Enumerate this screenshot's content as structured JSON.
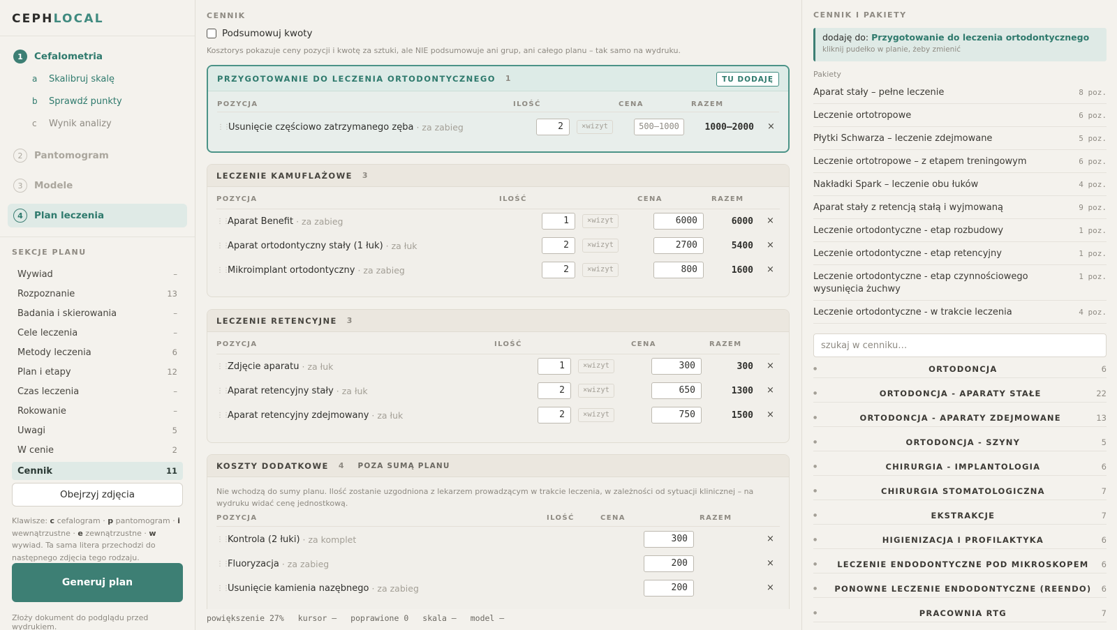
{
  "app": {
    "logo_a": "CEPH",
    "logo_b": "LOCAL"
  },
  "steps": [
    {
      "num": "1",
      "label": "Cefalometria"
    },
    {
      "num": "2",
      "label": "Pantomogram"
    },
    {
      "num": "3",
      "label": "Modele"
    },
    {
      "num": "4",
      "label": "Plan leczenia"
    }
  ],
  "substeps": [
    {
      "letter": "a",
      "label": "Skalibruj skalę"
    },
    {
      "letter": "b",
      "label": "Sprawdź punkty"
    },
    {
      "letter": "c",
      "label": "Wynik analizy"
    }
  ],
  "plan_sections": {
    "title": "SEKCJE PLANU",
    "items": [
      {
        "label": "Wywiad",
        "count": "–"
      },
      {
        "label": "Rozpoznanie",
        "count": "13"
      },
      {
        "label": "Badania i skierowania",
        "count": "–"
      },
      {
        "label": "Cele leczenia",
        "count": "–"
      },
      {
        "label": "Metody leczenia",
        "count": "6"
      },
      {
        "label": "Plan i etapy",
        "count": "12"
      },
      {
        "label": "Czas leczenia",
        "count": "–"
      },
      {
        "label": "Rokowanie",
        "count": "–"
      },
      {
        "label": "Uwagi",
        "count": "5"
      },
      {
        "label": "W cenie",
        "count": "2"
      },
      {
        "label": "Cennik",
        "count": "11"
      }
    ]
  },
  "sidebar": {
    "view_photos": "Obejrzyj zdjęcia",
    "hint_pre": "Klawisze: ",
    "hint_k1": "c",
    "hint_t1": " cefalogram · ",
    "hint_k2": "p",
    "hint_t2": " pantomogram · ",
    "hint_k3": "i",
    "hint_t3": " wewnątrzustne · ",
    "hint_k4": "e",
    "hint_t4": " zewnątrzustne · ",
    "hint_k5": "w",
    "hint_t5": " wywiad. Ta sama litera przechodzi do następnego zdjęcia tego rodzaju.",
    "generate": "Generuj plan",
    "footnote": "Złoży dokument do podglądu przed wydrukiem."
  },
  "pricing": {
    "title": "CENNIK",
    "sum_checkbox": "Podsumowuj kwoty",
    "sum_note": "Kosztorys pokazuje ceny pozycji i kwotę za sztuki, ale NIE podsumowuje ani grup, ani całego planu – tak samo na wydruku.",
    "col_position": "POZYCJA",
    "col_qty": "ILOŚĆ",
    "col_price": "CENA",
    "col_total": "RAZEM",
    "times_visit": "×wizyt",
    "delete": "×"
  },
  "groups": [
    {
      "name": "PRZYGOTOWANIE DO LECZENIA ORTODONTYCZNEGO",
      "count": "1",
      "add_here": "TU DODAJĘ",
      "items": [
        {
          "name": "Usunięcie częściowo zatrzymanego zęba",
          "unit": "· za zabieg",
          "qty": "2",
          "price": "500–1000",
          "total": "1000–2000"
        }
      ]
    },
    {
      "name": "LECZENIE KAMUFLAŻOWE",
      "count": "3",
      "items": [
        {
          "name": "Aparat Benefit",
          "unit": "· za zabieg",
          "qty": "1",
          "price": "6000",
          "total": "6000"
        },
        {
          "name": "Aparat ortodontyczny stały (1 łuk)",
          "unit": "· za łuk",
          "qty": "2",
          "price": "2700",
          "total": "5400"
        },
        {
          "name": "Mikroimplant ortodontyczny",
          "unit": "· za zabieg",
          "qty": "2",
          "price": "800",
          "total": "1600"
        }
      ]
    },
    {
      "name": "LECZENIE RETENCYJNE",
      "count": "3",
      "items": [
        {
          "name": "Zdjęcie aparatu",
          "unit": "· za łuk",
          "qty": "1",
          "price": "300",
          "total": "300"
        },
        {
          "name": "Aparat retencyjny stały",
          "unit": "· za łuk",
          "qty": "2",
          "price": "650",
          "total": "1300"
        },
        {
          "name": "Aparat retencyjny zdejmowany",
          "unit": "· za łuk",
          "qty": "2",
          "price": "750",
          "total": "1500"
        }
      ]
    },
    {
      "name": "KOSZTY DODATKOWE",
      "count": "4",
      "extra": "POZA SUMĄ PLANU",
      "note": "Nie wchodzą do sumy planu. Ilość zostanie uzgodniona z lekarzem prowadzącym w trakcie leczenia, w zależności od sytuacji klinicznej – na wydruku widać cenę jednostkową.",
      "items": [
        {
          "name": "Kontrola (2 łuki)",
          "unit": "· za komplet",
          "price": "300"
        },
        {
          "name": "Fluoryzacja",
          "unit": "· za zabieg",
          "price": "200"
        },
        {
          "name": "Usunięcie kamienia nazębnego",
          "unit": "· za zabieg",
          "price": "200"
        }
      ]
    }
  ],
  "statusbar": {
    "zoom": "powiększenie 27%",
    "cursor": "kursor –",
    "fixed": "poprawione 0",
    "scale": "skala –",
    "model": "model –"
  },
  "right": {
    "title": "CENNIK I PAKIETY",
    "target_pre": "dodaję do: ",
    "target_name": "Przygotowanie do leczenia ortodontycznego",
    "target_hint": "kliknij pudełko w planie, żeby zmienić",
    "packages_label": "Pakiety",
    "packages": [
      {
        "name": "Aparat stały – pełne leczenie",
        "count": "8 poz."
      },
      {
        "name": "Leczenie ortotropowe",
        "count": "6 poz."
      },
      {
        "name": "Płytki Schwarza – leczenie zdejmowane",
        "count": "5 poz."
      },
      {
        "name": "Leczenie ortotropowe – z etapem treningowym",
        "count": "6 poz."
      },
      {
        "name": "Nakładki Spark – leczenie obu łuków",
        "count": "4 poz."
      },
      {
        "name": "Aparat stały z retencją stałą i wyjmowaną",
        "count": "9 poz."
      },
      {
        "name": "Leczenie ortodontyczne - etap rozbudowy",
        "count": "1 poz."
      },
      {
        "name": "Leczenie ortodontyczne - etap retencyjny",
        "count": "1 poz."
      },
      {
        "name": "Leczenie ortodontyczne - etap czynnościowego wysunięcia żuchwy",
        "count": "1 poz."
      },
      {
        "name": "Leczenie ortodontyczne - w trakcie leczenia",
        "count": "4 poz."
      }
    ],
    "search_placeholder": "szukaj w cenniku…",
    "categories": [
      {
        "name": "ORTODONCJA",
        "count": "6"
      },
      {
        "name": "ORTODONCJA - APARATY STAŁE",
        "count": "22"
      },
      {
        "name": "ORTODONCJA - APARATY ZDEJMOWANE",
        "count": "13"
      },
      {
        "name": "ORTODONCJA - SZYNY",
        "count": "5"
      },
      {
        "name": "CHIRURGIA - IMPLANTOLOGIA",
        "count": "6"
      },
      {
        "name": "CHIRURGIA STOMATOLOGICZNA",
        "count": "7"
      },
      {
        "name": "EKSTRAKCJE",
        "count": "7"
      },
      {
        "name": "HIGIENIZACJA I PROFILAKTYKA",
        "count": "6"
      },
      {
        "name": "LECZENIE ENDODONTYCZNE POD MIKROSKOPEM",
        "count": "6"
      },
      {
        "name": "PONOWNE LECZENIE ENDODONTYCZNE (REENDO)",
        "count": "6"
      },
      {
        "name": "PRACOWNIA RTG",
        "count": "7"
      }
    ]
  }
}
